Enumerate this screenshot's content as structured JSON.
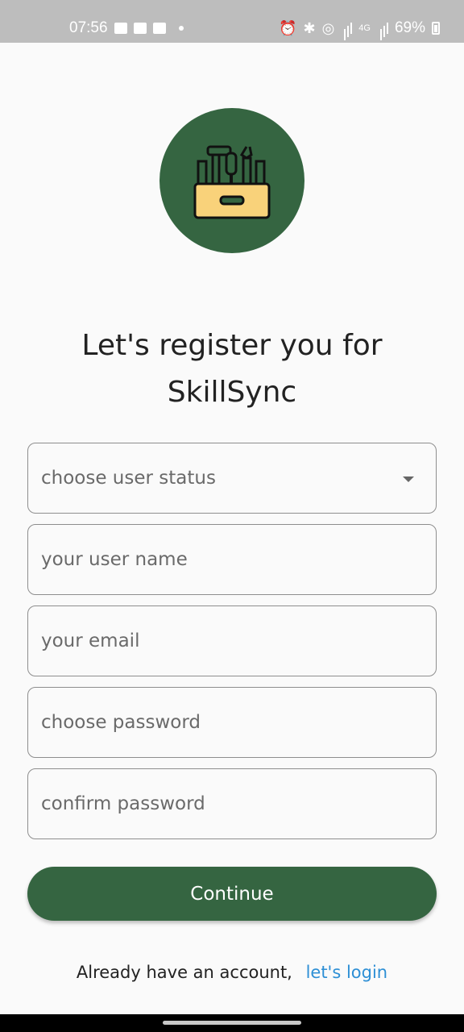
{
  "status_bar": {
    "time": "07:56",
    "network": "4G",
    "battery": "69%"
  },
  "colors": {
    "primary": "#356541",
    "link": "#2d8fd5",
    "background": "#fafafa",
    "logo_box": "#f9d27a"
  },
  "logo": {
    "icon": "toolbox-icon"
  },
  "title": {
    "line1": "Let's register you for",
    "line2": "SkillSync"
  },
  "form": {
    "user_status_placeholder": "choose user status",
    "username_placeholder": "your user name",
    "email_placeholder": "your email",
    "password_placeholder": "choose password",
    "confirm_password_placeholder": "confirm password",
    "continue_label": "Continue"
  },
  "footer": {
    "prompt": "Already have an account,",
    "link_label": "let's login"
  }
}
